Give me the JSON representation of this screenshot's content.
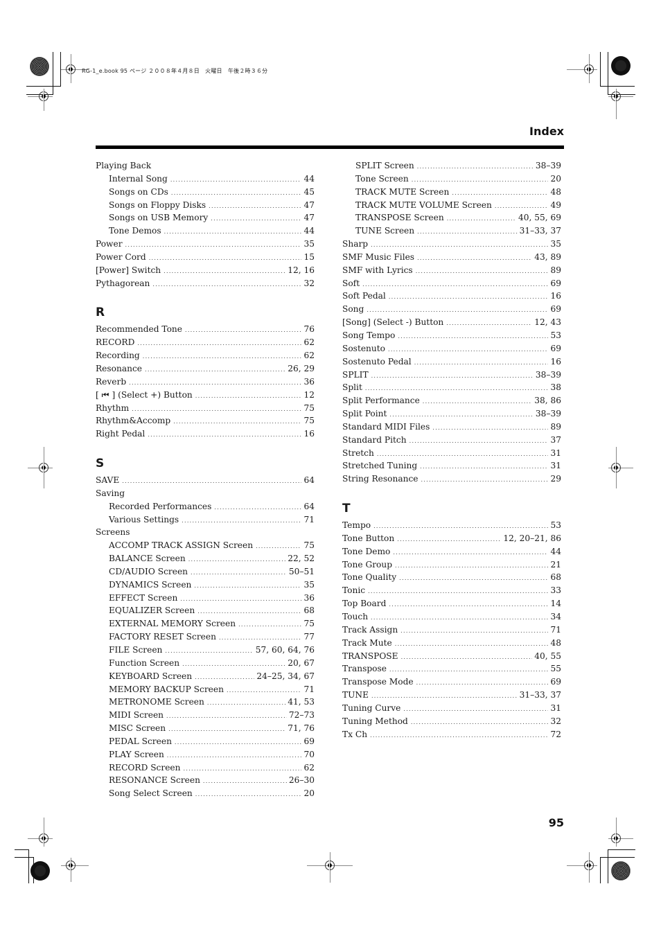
{
  "print_header": "RG-1_e.book  95 ページ  ２００８年４月８日　火曜日　午後２時３６分",
  "page_title": "Index",
  "page_number": "95",
  "left_column": [
    {
      "type": "entry",
      "term": "Playing Back",
      "pages": ""
    },
    {
      "type": "sub",
      "term": "Internal Song",
      "pages": "44"
    },
    {
      "type": "sub",
      "term": "Songs on CDs",
      "pages": "45"
    },
    {
      "type": "sub",
      "term": "Songs on Floppy Disks",
      "pages": "47"
    },
    {
      "type": "sub",
      "term": "Songs on USB Memory",
      "pages": "47"
    },
    {
      "type": "sub",
      "term": "Tone Demos",
      "pages": "44"
    },
    {
      "type": "entry",
      "term": "Power",
      "pages": "35"
    },
    {
      "type": "entry",
      "term": "Power Cord",
      "pages": "15"
    },
    {
      "type": "entry",
      "term": "[Power] Switch",
      "pages": "12, 16"
    },
    {
      "type": "entry",
      "term": "Pythagorean",
      "pages": "32"
    },
    {
      "type": "letter",
      "term": "R"
    },
    {
      "type": "entry",
      "term": "Recommended Tone",
      "pages": "76"
    },
    {
      "type": "entry",
      "term": "RECORD",
      "pages": "62"
    },
    {
      "type": "entry",
      "term": "Recording",
      "pages": "62"
    },
    {
      "type": "entry",
      "term": "Resonance",
      "pages": "26, 29"
    },
    {
      "type": "entry",
      "term": "Reverb",
      "pages": "36"
    },
    {
      "type": "entry",
      "term": "[ ⏮ ] (Select +) Button",
      "pages": "12"
    },
    {
      "type": "entry",
      "term": "Rhythm",
      "pages": "75"
    },
    {
      "type": "entry",
      "term": "Rhythm&Accomp",
      "pages": "75"
    },
    {
      "type": "entry",
      "term": "Right Pedal",
      "pages": "16"
    },
    {
      "type": "letter",
      "term": "S"
    },
    {
      "type": "entry",
      "term": "SAVE",
      "pages": "64"
    },
    {
      "type": "entry",
      "term": "Saving",
      "pages": ""
    },
    {
      "type": "sub",
      "term": "Recorded Performances",
      "pages": "64"
    },
    {
      "type": "sub",
      "term": "Various Settings",
      "pages": "71"
    },
    {
      "type": "entry",
      "term": "Screens",
      "pages": ""
    },
    {
      "type": "sub",
      "term": "ACCOMP TRACK ASSIGN Screen",
      "pages": "75"
    },
    {
      "type": "sub",
      "term": "BALANCE Screen",
      "pages": "22, 52"
    },
    {
      "type": "sub",
      "term": "CD/AUDIO Screen",
      "pages": "50–51"
    },
    {
      "type": "sub",
      "term": "DYNAMICS Screen",
      "pages": "35"
    },
    {
      "type": "sub",
      "term": "EFFECT Screen",
      "pages": "36"
    },
    {
      "type": "sub",
      "term": "EQUALIZER Screen",
      "pages": "68"
    },
    {
      "type": "sub",
      "term": "EXTERNAL MEMORY Screen",
      "pages": "75"
    },
    {
      "type": "sub",
      "term": "FACTORY RESET Screen",
      "pages": "77"
    },
    {
      "type": "sub",
      "term": "FILE Screen",
      "pages": "57, 60, 64, 76"
    },
    {
      "type": "sub",
      "term": "Function Screen",
      "pages": "20, 67"
    },
    {
      "type": "sub",
      "term": "KEYBOARD Screen",
      "pages": "24–25, 34, 67"
    },
    {
      "type": "sub",
      "term": "MEMORY BACKUP Screen",
      "pages": "71"
    },
    {
      "type": "sub",
      "term": "METRONOME Screen",
      "pages": "41, 53"
    },
    {
      "type": "sub",
      "term": "MIDI Screen",
      "pages": "72–73"
    },
    {
      "type": "sub",
      "term": "MISC Screen",
      "pages": "71, 76"
    },
    {
      "type": "sub",
      "term": "PEDAL Screen",
      "pages": "69"
    },
    {
      "type": "sub",
      "term": "PLAY Screen",
      "pages": "70"
    },
    {
      "type": "sub",
      "term": "RECORD Screen",
      "pages": "62"
    },
    {
      "type": "sub",
      "term": "RESONANCE Screen",
      "pages": "26–30"
    },
    {
      "type": "sub",
      "term": "Song Select Screen",
      "pages": "20"
    }
  ],
  "right_column": [
    {
      "type": "sub",
      "term": "SPLIT Screen",
      "pages": "38–39"
    },
    {
      "type": "sub",
      "term": "Tone Screen",
      "pages": "20"
    },
    {
      "type": "sub",
      "term": "TRACK MUTE Screen",
      "pages": "48"
    },
    {
      "type": "sub",
      "term": "TRACK MUTE VOLUME Screen",
      "pages": "49"
    },
    {
      "type": "sub",
      "term": "TRANSPOSE Screen",
      "pages": "40, 55, 69"
    },
    {
      "type": "sub",
      "term": "TUNE Screen",
      "pages": "31–33, 37"
    },
    {
      "type": "entry",
      "term": "Sharp",
      "pages": "35"
    },
    {
      "type": "entry",
      "term": "SMF Music Files",
      "pages": "43, 89"
    },
    {
      "type": "entry",
      "term": "SMF with Lyrics",
      "pages": "89"
    },
    {
      "type": "entry",
      "term": "Soft",
      "pages": "69"
    },
    {
      "type": "entry",
      "term": "Soft Pedal",
      "pages": "16"
    },
    {
      "type": "entry",
      "term": "Song",
      "pages": "69"
    },
    {
      "type": "entry",
      "term": "[Song] (Select -) Button",
      "pages": "12, 43"
    },
    {
      "type": "entry",
      "term": "Song Tempo",
      "pages": "53"
    },
    {
      "type": "entry",
      "term": "Sostenuto",
      "pages": "69"
    },
    {
      "type": "entry",
      "term": "Sostenuto Pedal",
      "pages": "16"
    },
    {
      "type": "entry",
      "term": "SPLIT",
      "pages": "38–39"
    },
    {
      "type": "entry",
      "term": "Split",
      "pages": "38"
    },
    {
      "type": "entry",
      "term": "Split Performance",
      "pages": "38, 86"
    },
    {
      "type": "entry",
      "term": "Split Point",
      "pages": "38–39"
    },
    {
      "type": "entry",
      "term": "Standard MIDI Files",
      "pages": "89"
    },
    {
      "type": "entry",
      "term": "Standard Pitch",
      "pages": "37"
    },
    {
      "type": "entry",
      "term": "Stretch",
      "pages": "31"
    },
    {
      "type": "entry",
      "term": "Stretched Tuning",
      "pages": "31"
    },
    {
      "type": "entry",
      "term": "String Resonance",
      "pages": "29"
    },
    {
      "type": "letter",
      "term": "T"
    },
    {
      "type": "entry",
      "term": "Tempo",
      "pages": "53"
    },
    {
      "type": "entry",
      "term": "Tone Button",
      "pages": "12, 20–21, 86"
    },
    {
      "type": "entry",
      "term": "Tone Demo",
      "pages": "44"
    },
    {
      "type": "entry",
      "term": "Tone Group",
      "pages": "21"
    },
    {
      "type": "entry",
      "term": "Tone Quality",
      "pages": "68"
    },
    {
      "type": "entry",
      "term": "Tonic",
      "pages": "33"
    },
    {
      "type": "entry",
      "term": "Top Board",
      "pages": "14"
    },
    {
      "type": "entry",
      "term": "Touch",
      "pages": "34"
    },
    {
      "type": "entry",
      "term": "Track Assign",
      "pages": "71"
    },
    {
      "type": "entry",
      "term": "Track Mute",
      "pages": "48"
    },
    {
      "type": "entry",
      "term": "TRANSPOSE",
      "pages": "40, 55"
    },
    {
      "type": "entry",
      "term": "Transpose",
      "pages": "55"
    },
    {
      "type": "entry",
      "term": "Transpose Mode",
      "pages": "69"
    },
    {
      "type": "entry",
      "term": "TUNE",
      "pages": "31–33, 37"
    },
    {
      "type": "entry",
      "term": "Tuning Curve",
      "pages": "31"
    },
    {
      "type": "entry",
      "term": "Tuning Method",
      "pages": "32"
    },
    {
      "type": "entry",
      "term": "Tx Ch",
      "pages": "72"
    }
  ]
}
